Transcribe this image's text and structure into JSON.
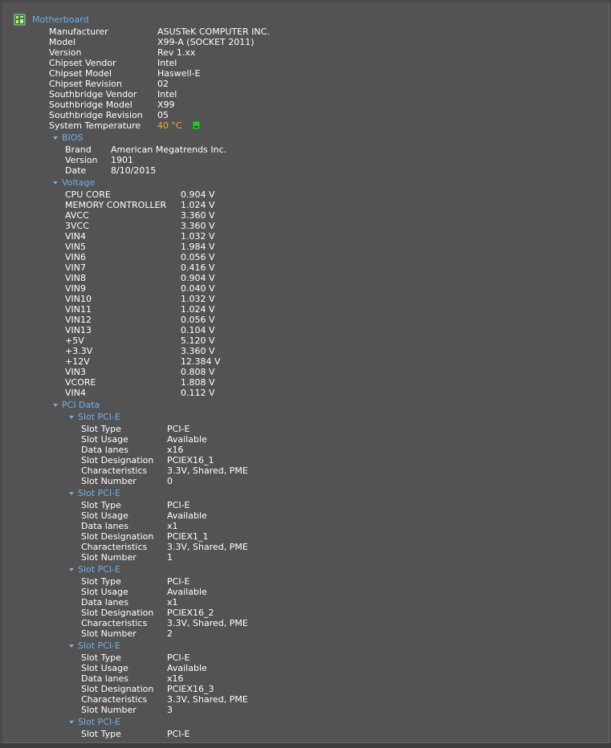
{
  "motherboard": {
    "title": "Motherboard",
    "props": [
      {
        "label": "Manufacturer",
        "value": "ASUSTeK COMPUTER INC."
      },
      {
        "label": "Model",
        "value": "X99-A (SOCKET 2011)"
      },
      {
        "label": "Version",
        "value": "Rev 1.xx"
      },
      {
        "label": "Chipset Vendor",
        "value": "Intel"
      },
      {
        "label": "Chipset Model",
        "value": "Haswell-E"
      },
      {
        "label": "Chipset Revision",
        "value": "02"
      },
      {
        "label": "Southbridge Vendor",
        "value": "Intel"
      },
      {
        "label": "Southbridge Model",
        "value": "X99"
      },
      {
        "label": "Southbridge Revision",
        "value": "05"
      }
    ],
    "temperature": {
      "label": "System Temperature",
      "value": "40 °C",
      "color": "#f0b417"
    }
  },
  "bios": {
    "title": "BIOS",
    "props": [
      {
        "label": "Brand",
        "value": "American Megatrends Inc."
      },
      {
        "label": "Version",
        "value": "1901"
      },
      {
        "label": "Date",
        "value": "8/10/2015"
      }
    ]
  },
  "voltage": {
    "title": "Voltage",
    "props": [
      {
        "label": "CPU CORE",
        "value": "0.904 V"
      },
      {
        "label": "MEMORY CONTROLLER",
        "value": "1.024 V"
      },
      {
        "label": "AVCC",
        "value": "3.360 V"
      },
      {
        "label": "3VCC",
        "value": "3.360 V"
      },
      {
        "label": "VIN4",
        "value": "1.032 V"
      },
      {
        "label": "VIN5",
        "value": "1.984 V"
      },
      {
        "label": "VIN6",
        "value": "0.056 V"
      },
      {
        "label": "VIN7",
        "value": "0.416 V"
      },
      {
        "label": "VIN8",
        "value": "0.904 V"
      },
      {
        "label": "VIN9",
        "value": "0.040 V"
      },
      {
        "label": "VIN10",
        "value": "1.032 V"
      },
      {
        "label": "VIN11",
        "value": "1.024 V"
      },
      {
        "label": "VIN12",
        "value": "0.056 V"
      },
      {
        "label": "VIN13",
        "value": "0.104 V"
      },
      {
        "label": "+5V",
        "value": "5.120 V"
      },
      {
        "label": "+3.3V",
        "value": "3.360 V"
      },
      {
        "label": "+12V",
        "value": "12.384 V"
      },
      {
        "label": "VIN3",
        "value": "0.808 V"
      },
      {
        "label": "VCORE",
        "value": "1.808 V"
      },
      {
        "label": "VIN4",
        "value": "0.112 V"
      }
    ]
  },
  "pci": {
    "title": "PCI Data",
    "slots": [
      {
        "title": "Slot PCI-E",
        "props": [
          {
            "label": "Slot Type",
            "value": "PCI-E"
          },
          {
            "label": "Slot Usage",
            "value": "Available"
          },
          {
            "label": "Data lanes",
            "value": "x16"
          },
          {
            "label": "Slot Designation",
            "value": "PCIEX16_1"
          },
          {
            "label": "Characteristics",
            "value": "3.3V, Shared, PME"
          },
          {
            "label": "Slot Number",
            "value": "0"
          }
        ]
      },
      {
        "title": "Slot PCI-E",
        "props": [
          {
            "label": "Slot Type",
            "value": "PCI-E"
          },
          {
            "label": "Slot Usage",
            "value": "Available"
          },
          {
            "label": "Data lanes",
            "value": "x1"
          },
          {
            "label": "Slot Designation",
            "value": "PCIEX1_1"
          },
          {
            "label": "Characteristics",
            "value": "3.3V, Shared, PME"
          },
          {
            "label": "Slot Number",
            "value": "1"
          }
        ]
      },
      {
        "title": "Slot PCI-E",
        "props": [
          {
            "label": "Slot Type",
            "value": "PCI-E"
          },
          {
            "label": "Slot Usage",
            "value": "Available"
          },
          {
            "label": "Data lanes",
            "value": "x1"
          },
          {
            "label": "Slot Designation",
            "value": "PCIEX16_2"
          },
          {
            "label": "Characteristics",
            "value": "3.3V, Shared, PME"
          },
          {
            "label": "Slot Number",
            "value": "2"
          }
        ]
      },
      {
        "title": "Slot PCI-E",
        "props": [
          {
            "label": "Slot Type",
            "value": "PCI-E"
          },
          {
            "label": "Slot Usage",
            "value": "Available"
          },
          {
            "label": "Data lanes",
            "value": "x16"
          },
          {
            "label": "Slot Designation",
            "value": "PCIEX16_3"
          },
          {
            "label": "Characteristics",
            "value": "3.3V, Shared, PME"
          },
          {
            "label": "Slot Number",
            "value": "3"
          }
        ]
      },
      {
        "title": "Slot PCI-E",
        "props": [
          {
            "label": "Slot Type",
            "value": "PCI-E"
          }
        ]
      }
    ]
  }
}
